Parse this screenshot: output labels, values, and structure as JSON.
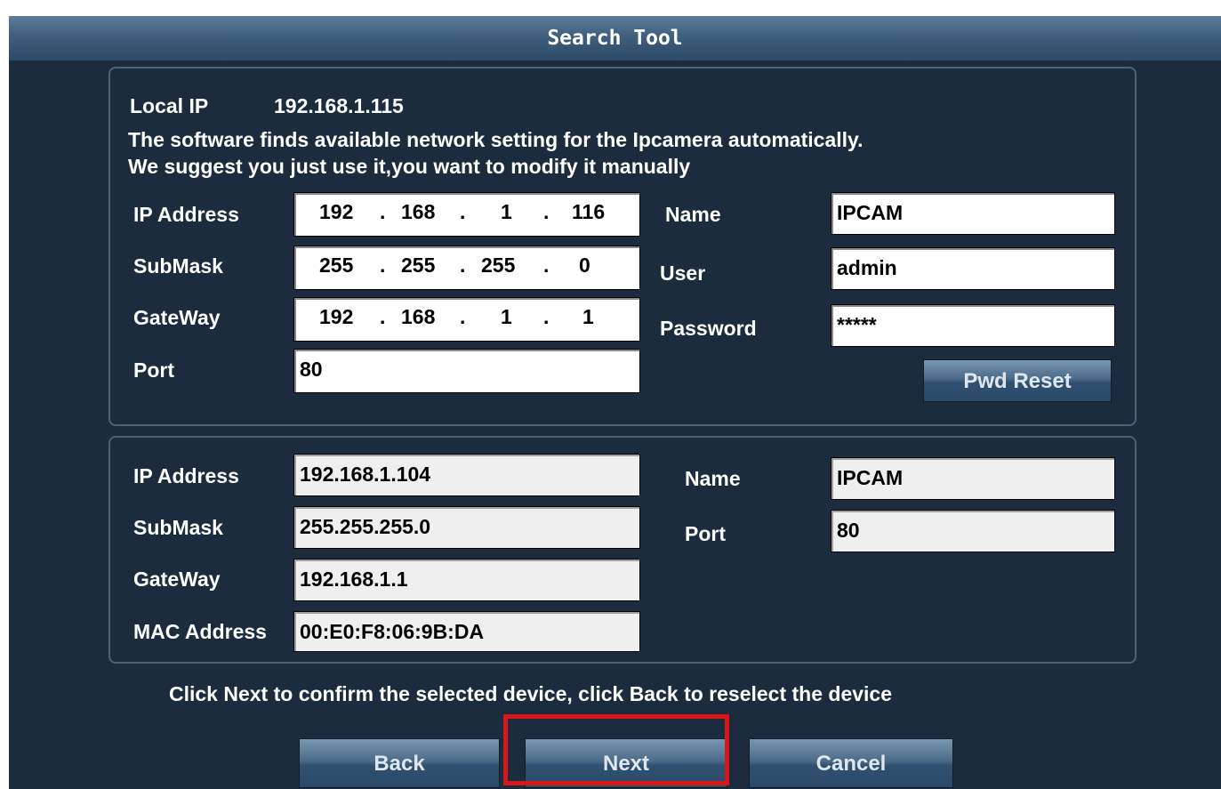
{
  "window": {
    "title": "Search Tool"
  },
  "config": {
    "local_ip_label": "Local IP",
    "local_ip_value": "192.168.1.115",
    "info_line1": "The software finds available network setting for the Ipcamera automatically.",
    "info_line2": "We suggest you just use it,you want to modify it manually",
    "ip_label": "IP Address",
    "ip_octets": [
      "192",
      "168",
      "1",
      "116"
    ],
    "submask_label": "SubMask",
    "submask_octets": [
      "255",
      "255",
      "255",
      "0"
    ],
    "gateway_label": "GateWay",
    "gateway_octets": [
      "192",
      "168",
      "1",
      "1"
    ],
    "port_label": "Port",
    "port_value": "80",
    "name_label": "Name",
    "name_value": "IPCAM",
    "user_label": "User",
    "user_value": "admin",
    "password_label": "Password",
    "password_value": "*****",
    "pwd_reset_label": "Pwd Reset"
  },
  "device": {
    "ip_label": "IP Address",
    "ip_value": "192.168.1.104",
    "submask_label": "SubMask",
    "submask_value": "255.255.255.0",
    "gateway_label": "GateWay",
    "gateway_value": "192.168.1.1",
    "mac_label": "MAC Address",
    "mac_value": "00:E0:F8:06:9B:DA",
    "name_label": "Name",
    "name_value": "IPCAM",
    "port_label": "Port",
    "port_value": "80"
  },
  "footer": {
    "hint": "Click Next to confirm the selected device, click Back to reselect the device",
    "back_label": "Back",
    "next_label": "Next",
    "cancel_label": "Cancel"
  },
  "colors": {
    "background": "#1c2b3d",
    "highlight": "#d81818"
  }
}
